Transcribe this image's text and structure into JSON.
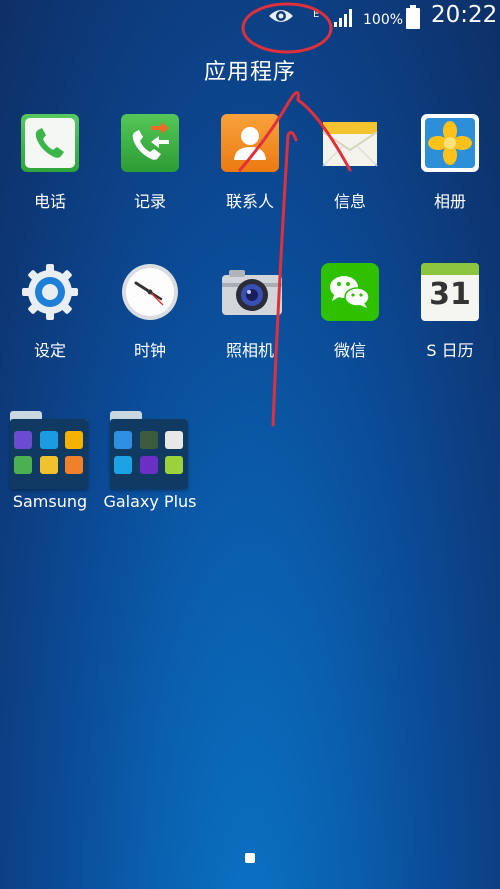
{
  "status_bar": {
    "battery_percent": "100%",
    "time": "20:22",
    "network_type": "E",
    "icons": [
      "eye-icon",
      "signal-icon",
      "battery-icon"
    ]
  },
  "screen_title": "应用程序",
  "apps": [
    {
      "label": "电话",
      "icon": "phone-icon"
    },
    {
      "label": "记录",
      "icon": "call-log-icon"
    },
    {
      "label": "联系人",
      "icon": "contacts-icon"
    },
    {
      "label": "信息",
      "icon": "messages-icon"
    },
    {
      "label": "相册",
      "icon": "gallery-icon"
    },
    {
      "label": "设定",
      "icon": "settings-icon"
    },
    {
      "label": "时钟",
      "icon": "clock-icon"
    },
    {
      "label": "照相机",
      "icon": "camera-icon"
    },
    {
      "label": "微信",
      "icon": "wechat-icon"
    },
    {
      "label": "S 日历",
      "icon": "calendar-icon",
      "calendar_day": "31"
    }
  ],
  "folders": [
    {
      "label": "Samsung"
    },
    {
      "label": "Galaxy Plus"
    }
  ],
  "colors": {
    "annotation": "#e0303c",
    "phone_green": "#3ab54a",
    "contacts_orange": "#f08a1c",
    "wechat_green": "#2dc100"
  }
}
